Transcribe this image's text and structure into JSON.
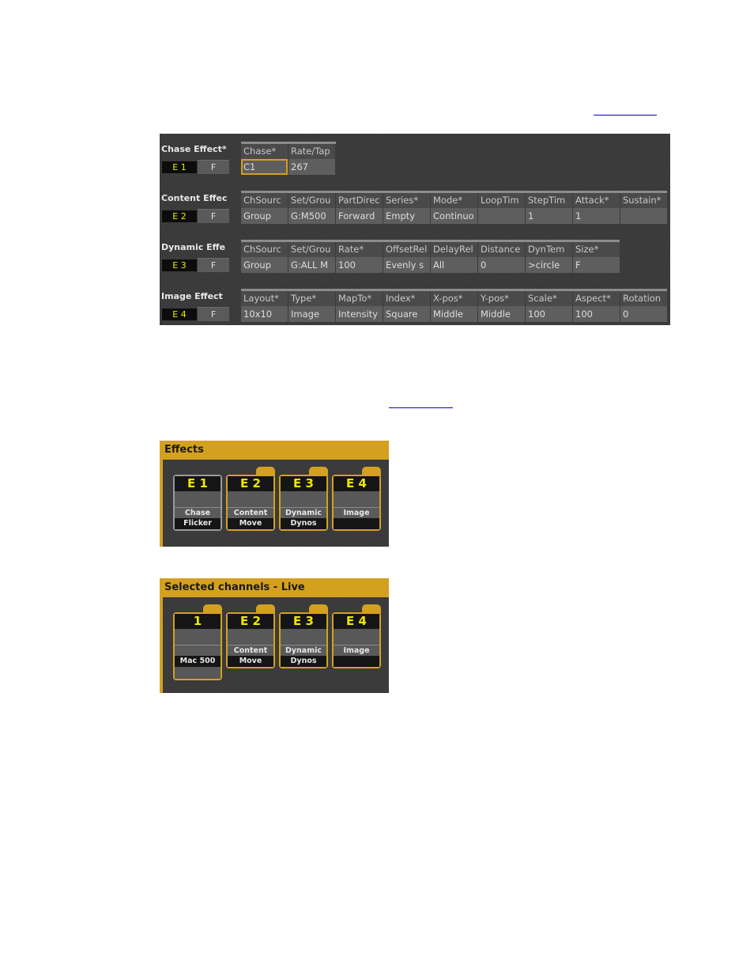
{
  "links": [
    {
      "text": ""
    },
    {
      "text": ""
    }
  ],
  "effect_table": {
    "rows": [
      {
        "title": "Chase Effect*",
        "effect_button": "E 1",
        "f_button": "F",
        "columns": [
          "Chase*",
          "Rate/Tap"
        ],
        "values": [
          "C1",
          "267"
        ],
        "selected_index": 0
      },
      {
        "title": "Content Effec",
        "effect_button": "E 2",
        "f_button": "F",
        "columns": [
          "ChSourc",
          "Set/Grou",
          "PartDirec",
          "Series*",
          "Mode*",
          "LoopTim",
          "StepTim",
          "Attack*",
          "Sustain*"
        ],
        "values": [
          "Group",
          "G:M500",
          "Forward",
          "Empty",
          "Continuo",
          "",
          "1",
          "1",
          ""
        ]
      },
      {
        "title": "Dynamic Effe",
        "effect_button": "E 3",
        "f_button": "F",
        "columns": [
          "ChSourc",
          "Set/Grou",
          "Rate*",
          "OffsetRel",
          "DelayRel",
          "Distance",
          "DynTem",
          "Size*"
        ],
        "values": [
          "Group",
          "G:ALL M",
          "100",
          "Evenly s",
          "All",
          "0",
          ">circle",
          "F"
        ]
      },
      {
        "title": "Image Effect",
        "effect_button": "E 4",
        "f_button": "F",
        "columns": [
          "Layout*",
          "Type*",
          "MapTo*",
          "Index*",
          "X-pos*",
          "Y-pos*",
          "Scale*",
          "Aspect*",
          "Rotation"
        ],
        "values": [
          "10x10",
          "Image",
          "Intensity",
          "Square",
          "Middle",
          "Middle",
          "100",
          "100",
          "0"
        ]
      }
    ]
  },
  "effects_window": {
    "title": "Effects",
    "tiles": [
      {
        "id": "E 1",
        "line1": "Chase",
        "line2": "Flicker",
        "style": "white"
      },
      {
        "id": "E 2",
        "line1": "Content",
        "line2": "Move",
        "style": "gold"
      },
      {
        "id": "E 3",
        "line1": "Dynamic",
        "line2": "Dynos",
        "style": "gold"
      },
      {
        "id": "E 4",
        "line1": "Image",
        "line2": "",
        "style": "gold"
      }
    ]
  },
  "channels_window": {
    "title": "Selected channels - Live",
    "tiles": [
      {
        "id": "1",
        "line1": "",
        "line2": "Mac 500",
        "style": "gold"
      },
      {
        "id": "E 2",
        "line1": "Content",
        "line2": "Move",
        "style": "gold"
      },
      {
        "id": "E 3",
        "line1": "Dynamic",
        "line2": "Dynos",
        "style": "gold"
      },
      {
        "id": "E 4",
        "line1": "Image",
        "line2": "",
        "style": "gold"
      }
    ]
  },
  "colors": {
    "accent_gold": "#d4a020",
    "effect_number_yellow": "#f0e800",
    "panel_dark": "#3a3a3a",
    "link_blue": "#0000dd"
  }
}
